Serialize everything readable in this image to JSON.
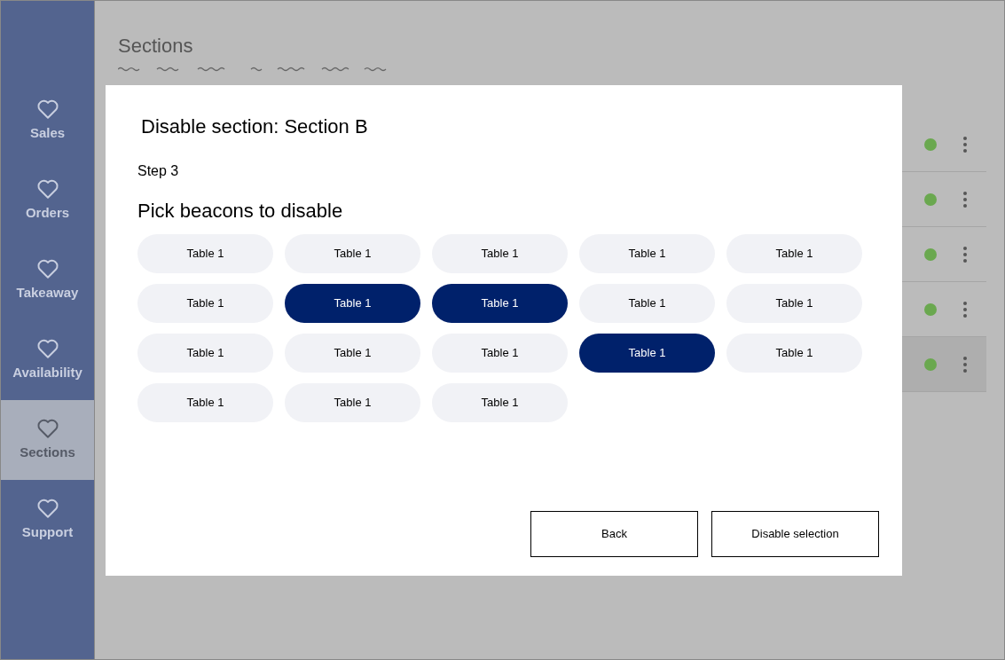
{
  "sidebar": {
    "items": [
      {
        "label": "Sales",
        "selected": false
      },
      {
        "label": "Orders",
        "selected": false
      },
      {
        "label": "Takeaway",
        "selected": false
      },
      {
        "label": "Availability",
        "selected": false
      },
      {
        "label": "Sections",
        "selected": true
      },
      {
        "label": "Support",
        "selected": false
      }
    ]
  },
  "page": {
    "title": "Sections"
  },
  "rows": [
    {
      "color": "#6aa84f",
      "selected": false
    },
    {
      "color": "#6aa84f",
      "selected": false
    },
    {
      "color": "#6aa84f",
      "selected": false
    },
    {
      "color": "#6aa84f",
      "selected": false
    },
    {
      "color": "#6aa84f",
      "selected": true
    }
  ],
  "dialog": {
    "title": "Disable section: Section B",
    "step": "Step 3",
    "heading": "Pick beacons to disable",
    "beacons": [
      {
        "label": "Table 1",
        "selected": false
      },
      {
        "label": "Table 1",
        "selected": false
      },
      {
        "label": "Table 1",
        "selected": false
      },
      {
        "label": "Table 1",
        "selected": false
      },
      {
        "label": "Table 1",
        "selected": false
      },
      {
        "label": "Table 1",
        "selected": false
      },
      {
        "label": "Table 1",
        "selected": true
      },
      {
        "label": "Table 1",
        "selected": true
      },
      {
        "label": "Table 1",
        "selected": false
      },
      {
        "label": "Table 1",
        "selected": false
      },
      {
        "label": "Table 1",
        "selected": false
      },
      {
        "label": "Table 1",
        "selected": false
      },
      {
        "label": "Table 1",
        "selected": false
      },
      {
        "label": "Table 1",
        "selected": true
      },
      {
        "label": "Table 1",
        "selected": false
      },
      {
        "label": "Table 1",
        "selected": false
      },
      {
        "label": "Table 1",
        "selected": false
      },
      {
        "label": "Table 1",
        "selected": false
      }
    ],
    "buttons": [
      "Back",
      "Disable selection"
    ]
  }
}
